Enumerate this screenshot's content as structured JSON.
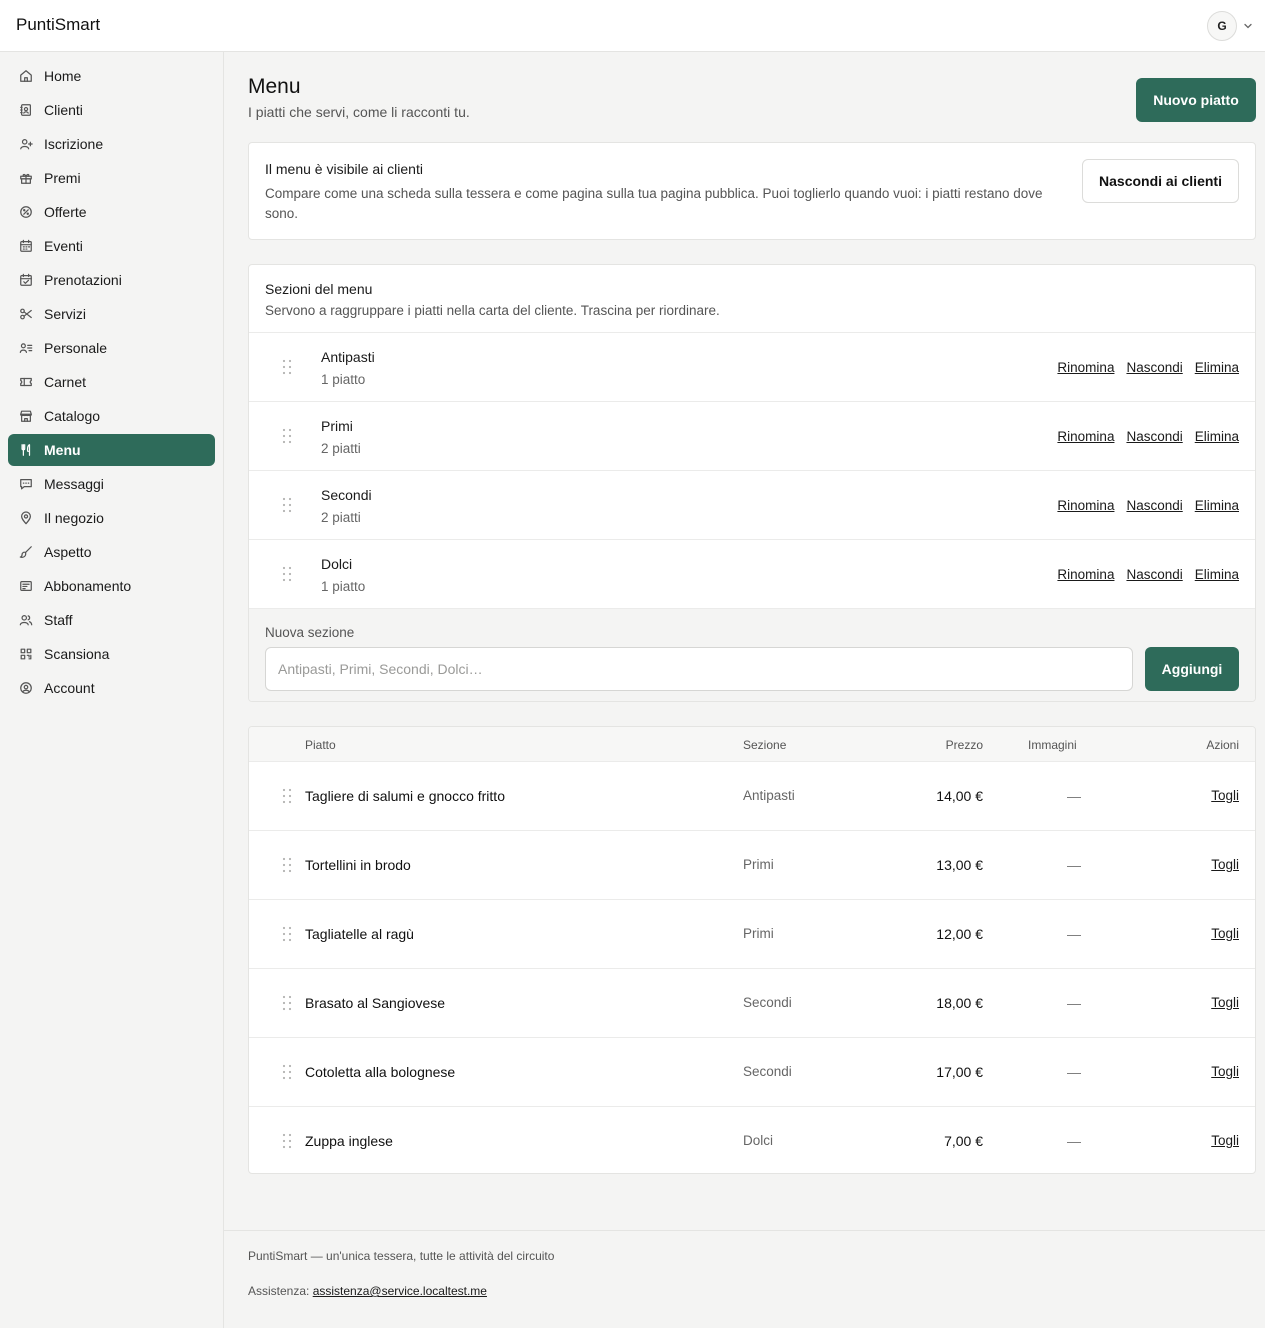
{
  "app": {
    "brand": "PuntiSmart",
    "user_initial": "G"
  },
  "sidebar": {
    "items": [
      {
        "label": "Home",
        "icon": "home-icon"
      },
      {
        "label": "Clienti",
        "icon": "contacts-icon"
      },
      {
        "label": "Iscrizione",
        "icon": "user-plus-icon"
      },
      {
        "label": "Premi",
        "icon": "gift-icon"
      },
      {
        "label": "Offerte",
        "icon": "badge-percent-icon"
      },
      {
        "label": "Eventi",
        "icon": "calendar-icon"
      },
      {
        "label": "Prenotazioni",
        "icon": "calendar-check-icon"
      },
      {
        "label": "Servizi",
        "icon": "scissors-icon"
      },
      {
        "label": "Personale",
        "icon": "user-list-icon"
      },
      {
        "label": "Carnet",
        "icon": "ticket-icon"
      },
      {
        "label": "Catalogo",
        "icon": "store-icon"
      },
      {
        "label": "Menu",
        "icon": "utensils-icon",
        "active": true
      },
      {
        "label": "Messaggi",
        "icon": "message-icon"
      },
      {
        "label": "Il negozio",
        "icon": "map-pin-icon"
      },
      {
        "label": "Aspetto",
        "icon": "brush-icon"
      },
      {
        "label": "Abbonamento",
        "icon": "receipt-icon"
      },
      {
        "label": "Staff",
        "icon": "users-icon"
      },
      {
        "label": "Scansiona",
        "icon": "scan-icon"
      },
      {
        "label": "Account",
        "icon": "user-circle-icon"
      }
    ]
  },
  "page": {
    "title": "Menu",
    "subtitle": "I piatti che servi, come li racconti tu.",
    "new_dish_label": "Nuovo piatto"
  },
  "visibility": {
    "title": "Il menu è visibile ai clienti",
    "description": "Compare come una scheda sulla tessera e come pagina sulla tua pagina pubblica. Puoi toglierlo quando vuoi: i piatti restano dove sono.",
    "button_label": "Nascondi ai clienti"
  },
  "sections": {
    "title": "Sezioni del menu",
    "description": "Servono a raggruppare i piatti nella carta del cliente. Trascina per riordinare.",
    "action_rename": "Rinomina",
    "action_hide": "Nascondi",
    "action_delete": "Elimina",
    "rows": [
      {
        "name": "Antipasti",
        "count": "1 piatto"
      },
      {
        "name": "Primi",
        "count": "2 piatti"
      },
      {
        "name": "Secondi",
        "count": "2 piatti"
      },
      {
        "name": "Dolci",
        "count": "1 piatto"
      }
    ],
    "new_section_label": "Nuova sezione",
    "new_section_placeholder": "Antipasti, Primi, Secondi, Dolci…",
    "add_label": "Aggiungi"
  },
  "dishes": {
    "columns": {
      "dish": "Piatto",
      "section": "Sezione",
      "price": "Prezzo",
      "images": "Immagini",
      "actions": "Azioni"
    },
    "action_label": "Togli",
    "rows": [
      {
        "name": "Tagliere di salumi e gnocco fritto",
        "section": "Antipasti",
        "price": "14,00 €",
        "images": "—"
      },
      {
        "name": "Tortellini in brodo",
        "section": "Primi",
        "price": "13,00 €",
        "images": "—"
      },
      {
        "name": "Tagliatelle al ragù",
        "section": "Primi",
        "price": "12,00 €",
        "images": "—"
      },
      {
        "name": "Brasato al Sangiovese",
        "section": "Secondi",
        "price": "18,00 €",
        "images": "—"
      },
      {
        "name": "Cotoletta alla bolognese",
        "section": "Secondi",
        "price": "17,00 €",
        "images": "—"
      },
      {
        "name": "Zuppa inglese",
        "section": "Dolci",
        "price": "7,00 €",
        "images": "—"
      }
    ]
  },
  "footer": {
    "tagline": "PuntiSmart — un'unica tessera, tutte le attività del circuito",
    "support_label": "Assistenza:",
    "support_email": "assistenza@service.localtest.me"
  },
  "colors": {
    "accent": "#2e6b5a",
    "background": "#f4f4f3",
    "card": "#ffffff",
    "border": "#e4e4e2"
  }
}
